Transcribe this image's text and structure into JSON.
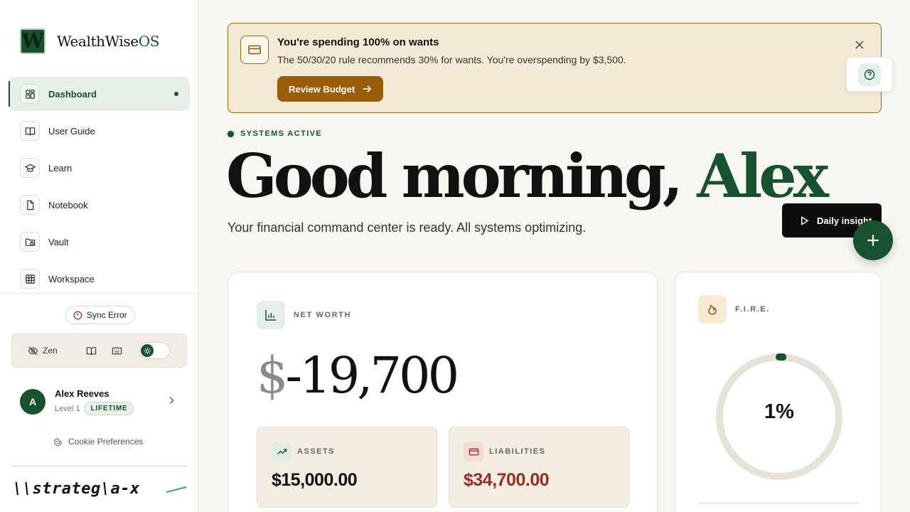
{
  "brand": {
    "letter": "W",
    "name": "WealthWise",
    "suffix": "OS"
  },
  "nav": [
    {
      "label": "Dashboard",
      "icon": "dashboard-icon",
      "active": true
    },
    {
      "label": "User Guide",
      "icon": "book-open-icon"
    },
    {
      "label": "Learn",
      "icon": "graduation-cap-icon"
    },
    {
      "label": "Notebook",
      "icon": "file-icon"
    },
    {
      "label": "Vault",
      "icon": "folder-lock-icon"
    },
    {
      "label": "Workspace",
      "icon": "grid-icon"
    }
  ],
  "sync": {
    "label": "Sync Error"
  },
  "toolbar": {
    "zen_label": "Zen"
  },
  "profile": {
    "initial": "A",
    "name": "Alex Reeves",
    "level": "Level 1",
    "badge": "LIFETIME"
  },
  "cookie": {
    "label": "Cookie Preferences"
  },
  "alert": {
    "title": "You're spending 100% on wants",
    "text": "The 50/30/20 rule recommends 30% for wants. You're overspending by $3,500.",
    "button": "Review Budget"
  },
  "status": {
    "label": "SYSTEMS ACTIVE"
  },
  "greeting": {
    "prefix": "Good morning, ",
    "name": "Alex"
  },
  "subtitle": "Your financial command center is ready. All systems optimizing.",
  "insight": {
    "label": "Daily insight"
  },
  "net_worth": {
    "label": "NET WORTH",
    "currency": "$",
    "value": "-19,700",
    "assets_label": "ASSETS",
    "assets_value": "$15,000.00",
    "liabilities_label": "LIABILITIES",
    "liabilities_value": "$34,700.00"
  },
  "fire": {
    "label": "F.I.R.E.",
    "progress": 0.01,
    "progress_text": "1%"
  },
  "footer_logo": "\\\\strateg\\a-x",
  "colors": {
    "accent": "#17512f",
    "warning": "#9a5d0c",
    "danger": "#9c2b24",
    "background": "#f8f6f1"
  }
}
